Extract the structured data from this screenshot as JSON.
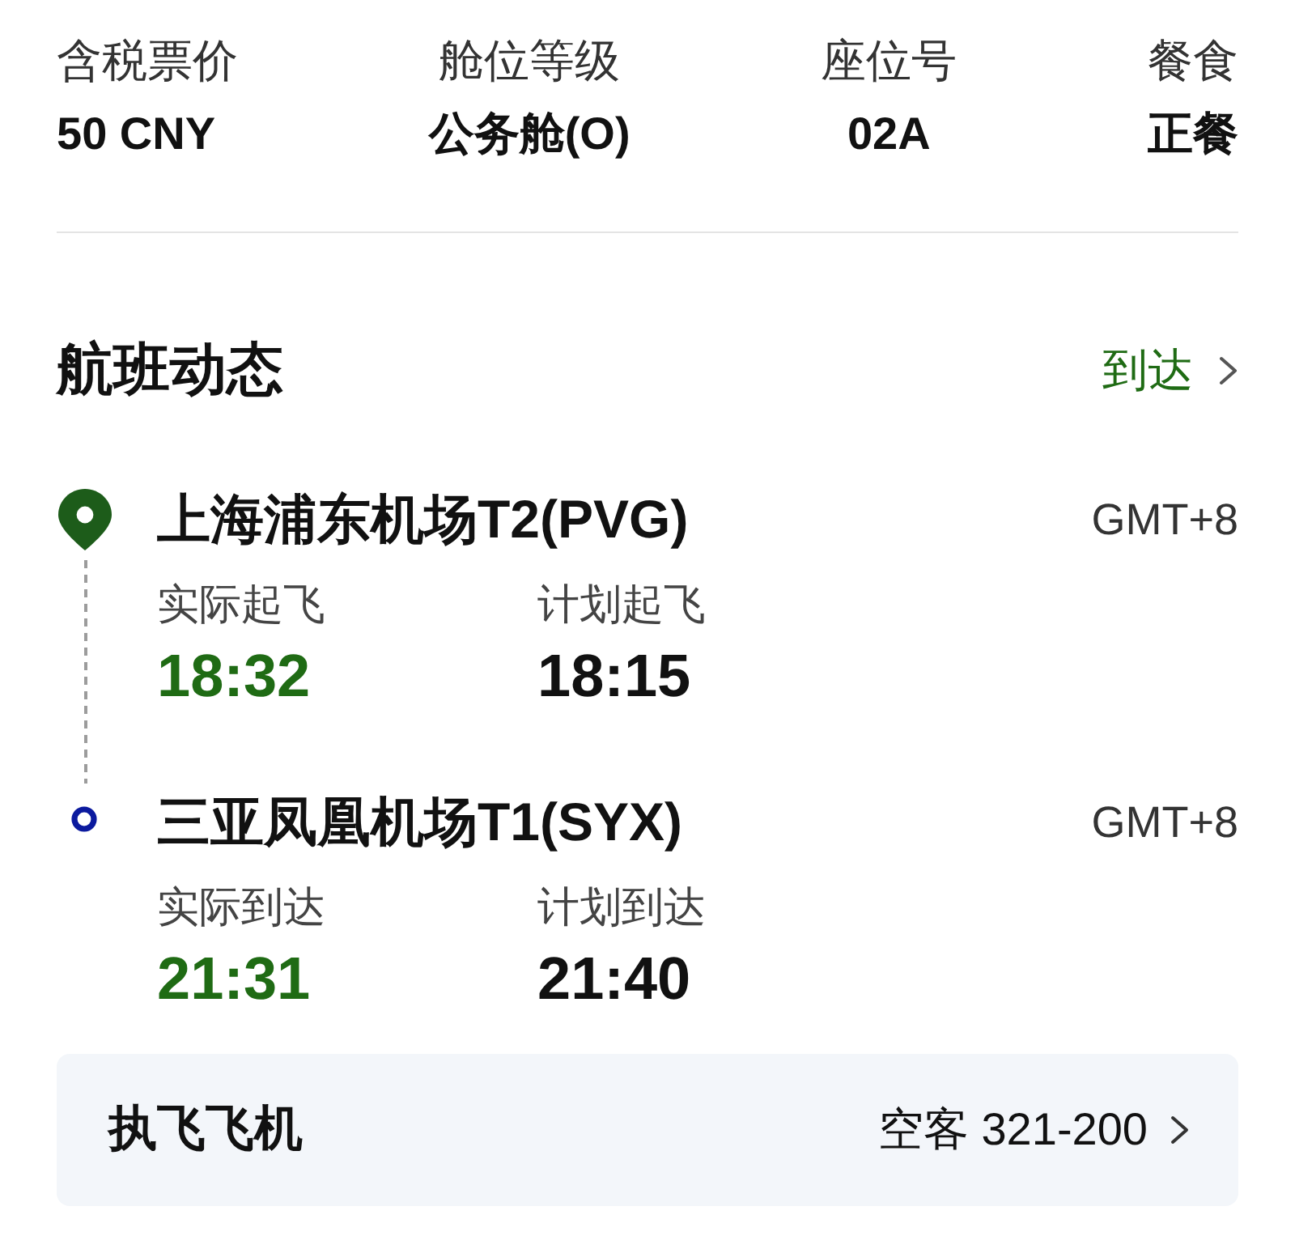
{
  "fare_summary": [
    {
      "label": "含税票价",
      "value": "50 CNY"
    },
    {
      "label": "舱位等级",
      "value": "公务舱(O)"
    },
    {
      "label": "座位号",
      "value": "02A"
    },
    {
      "label": "餐食",
      "value": "正餐"
    }
  ],
  "flight_status": {
    "title": "航班动态",
    "link": {
      "label": "到达"
    },
    "segments": [
      {
        "kind": "departure",
        "airport": "上海浦东机场T2(PVG)",
        "timezone": "GMT+8",
        "actual": {
          "label": "实际起飞",
          "time": "18:32"
        },
        "scheduled": {
          "label": "计划起飞",
          "time": "18:15"
        }
      },
      {
        "kind": "arrival",
        "airport": "三亚凤凰机场T1(SYX)",
        "timezone": "GMT+8",
        "actual": {
          "label": "实际到达",
          "time": "21:31"
        },
        "scheduled": {
          "label": "计划到达",
          "time": "21:40"
        }
      }
    ]
  },
  "aircraft": {
    "label": "执飞飞机",
    "value": "空客 321-200"
  }
}
